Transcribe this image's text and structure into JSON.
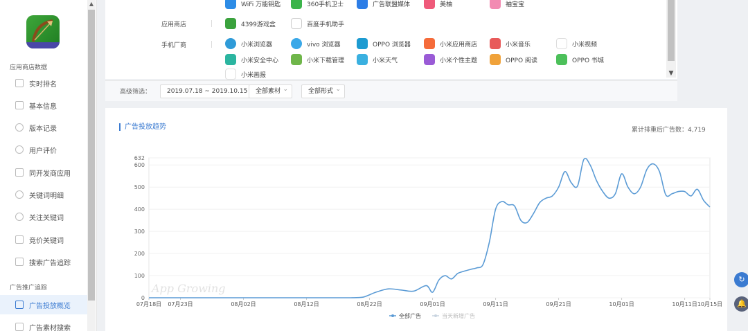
{
  "sidebar": {
    "section1": "应用商店数据",
    "items": [
      {
        "label": "实时排名"
      },
      {
        "label": "基本信息"
      },
      {
        "label": "版本记录"
      },
      {
        "label": "用户评价"
      },
      {
        "label": "同开发商应用"
      },
      {
        "label": "关键词明细"
      },
      {
        "label": "关注关键词"
      },
      {
        "label": "竞价关键词"
      },
      {
        "label": "搜索广告追踪"
      }
    ],
    "section2": "广告推广追踪",
    "items2": [
      {
        "label": "广告投放概览"
      },
      {
        "label": "广告素材搜索"
      }
    ]
  },
  "top_panel": {
    "row1": [
      "WiFi 万能钥匙",
      "360手机卫士",
      "广告联盟媒体",
      "美柚",
      "袖宝宝"
    ],
    "app_store_label": "应用商店",
    "row2": [
      "4399游戏盒",
      "百度手机助手"
    ],
    "phone_vendor_label": "手机厂商",
    "row3": [
      "小米浏览器",
      "vivo 浏览器",
      "OPPO 浏览器",
      "小米应用商店",
      "小米音乐",
      "小米视频"
    ],
    "row4": [
      "小米安全中心",
      "小米下载管理",
      "小米天气",
      "小米个性主题",
      "OPPO 阅读",
      "OPPO 书城"
    ],
    "row5": [
      "小米画报"
    ]
  },
  "filters": {
    "label": "高级筛选：",
    "date_range": "2019.07.18 ~ 2019.10.15",
    "material": "全部素材",
    "format": "全部形式"
  },
  "card": {
    "title": "广告投放趋势",
    "stat": "累计排重后广告数：4,719"
  },
  "chart_data": {
    "type": "line",
    "title": "广告投放趋势",
    "xlabel": "",
    "ylabel": "",
    "ylim": [
      0,
      632
    ],
    "yticks": [
      0,
      100,
      200,
      300,
      400,
      500,
      600,
      632
    ],
    "xticks": [
      "07月18日",
      "07月23日",
      "08月02日",
      "08月12日",
      "08月22日",
      "09月01日",
      "09月11日",
      "09月21日",
      "10月01日",
      "10月11日",
      "10月15日"
    ],
    "x_start": "2019-07-18",
    "x_end": "2019-10-15",
    "legend_position": "bottom",
    "watermark": "App Growing",
    "series": [
      {
        "name": "全部广告",
        "color": "#5b9bd5",
        "points": [
          [
            "2019-07-18",
            0
          ],
          [
            "2019-07-25",
            0
          ],
          [
            "2019-08-01",
            0
          ],
          [
            "2019-08-08",
            0
          ],
          [
            "2019-08-15",
            0
          ],
          [
            "2019-08-19",
            0
          ],
          [
            "2019-08-21",
            3
          ],
          [
            "2019-08-23",
            25
          ],
          [
            "2019-08-25",
            40
          ],
          [
            "2019-08-27",
            35
          ],
          [
            "2019-08-29",
            30
          ],
          [
            "2019-08-31",
            55
          ],
          [
            "2019-09-01",
            25
          ],
          [
            "2019-09-02",
            80
          ],
          [
            "2019-09-03",
            100
          ],
          [
            "2019-09-04",
            85
          ],
          [
            "2019-09-05",
            110
          ],
          [
            "2019-09-06",
            120
          ],
          [
            "2019-09-07",
            128
          ],
          [
            "2019-09-08",
            135
          ],
          [
            "2019-09-09",
            150
          ],
          [
            "2019-09-10",
            250
          ],
          [
            "2019-09-11",
            400
          ],
          [
            "2019-09-12",
            435
          ],
          [
            "2019-09-13",
            420
          ],
          [
            "2019-09-14",
            415
          ],
          [
            "2019-09-15",
            350
          ],
          [
            "2019-09-16",
            340
          ],
          [
            "2019-09-17",
            380
          ],
          [
            "2019-09-18",
            430
          ],
          [
            "2019-09-19",
            450
          ],
          [
            "2019-09-20",
            460
          ],
          [
            "2019-09-21",
            500
          ],
          [
            "2019-09-22",
            570
          ],
          [
            "2019-09-23",
            520
          ],
          [
            "2019-09-24",
            505
          ],
          [
            "2019-09-25",
            625
          ],
          [
            "2019-09-26",
            600
          ],
          [
            "2019-09-27",
            530
          ],
          [
            "2019-09-28",
            480
          ],
          [
            "2019-09-29",
            450
          ],
          [
            "2019-09-30",
            470
          ],
          [
            "2019-10-01",
            560
          ],
          [
            "2019-10-02",
            500
          ],
          [
            "2019-10-03",
            470
          ],
          [
            "2019-10-04",
            500
          ],
          [
            "2019-10-05",
            580
          ],
          [
            "2019-10-06",
            605
          ],
          [
            "2019-10-07",
            570
          ],
          [
            "2019-10-08",
            465
          ],
          [
            "2019-10-09",
            470
          ],
          [
            "2019-10-10",
            480
          ],
          [
            "2019-10-11",
            480
          ],
          [
            "2019-10-12",
            460
          ],
          [
            "2019-10-13",
            490
          ],
          [
            "2019-10-14",
            440
          ],
          [
            "2019-10-15",
            410
          ]
        ]
      },
      {
        "name": "当天新增广告",
        "color": "#c9d4e0",
        "points": []
      }
    ]
  }
}
